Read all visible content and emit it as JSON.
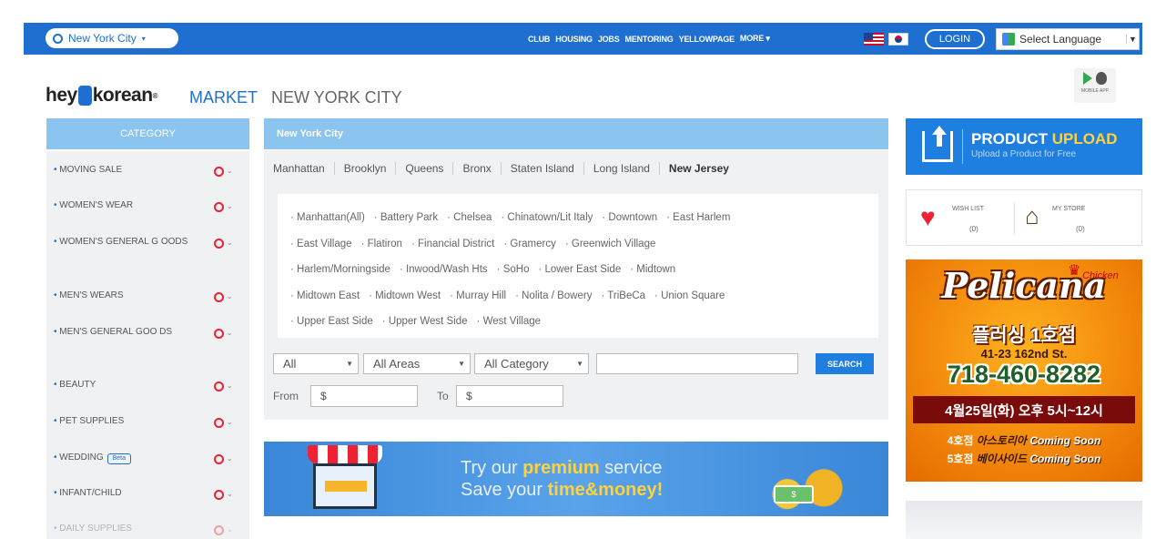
{
  "topbar": {
    "city": "New York City",
    "nav": [
      "CLUB",
      "HOUSING",
      "JOBS",
      "MENTORING",
      "YELLOWPAGE",
      "MORE ▾"
    ],
    "login": "LOGIN",
    "language": "Select Language"
  },
  "header": {
    "logo_pre": "hey",
    "logo_post": "korean",
    "logo_reg": "®",
    "market": "MARKET",
    "city_title": "NEW YORK CITY",
    "mobile_app": "MOBILE APP"
  },
  "sidebar": {
    "title": "CATEGORY",
    "items": [
      "MOVING SALE",
      "WOMEN'S WEAR",
      "WOMEN'S GENERAL G OODS",
      "MEN'S WEARS",
      "MEN'S GENERAL GOO DS",
      "BEAUTY",
      "PET SUPPLIES",
      "WEDDING",
      "INFANT/CHILD",
      "DAILY SUPPLIES"
    ],
    "beta_label": "Beta"
  },
  "main": {
    "city_bar": "New York City",
    "boroughs": [
      "Manhattan",
      "Brooklyn",
      "Queens",
      "Bronx",
      "Staten Island",
      "Long Island",
      "New Jersey"
    ],
    "neighborhoods": [
      "Manhattan(All)",
      "Battery Park",
      "Chelsea",
      "Chinatown/Lit Italy",
      "Downtown",
      "East Harlem",
      "East Village",
      "Flatiron",
      "Financial District",
      "Gramercy",
      "Greenwich Village",
      "Harlem/Morningside",
      "Inwood/Wash Hts",
      "SoHo",
      "Lower East Side",
      "Midtown",
      "Midtown East",
      "Midtown West",
      "Murray Hill",
      "Nolita / Bowery",
      "TriBeCa",
      "Union Square",
      "Upper East Side",
      "Upper West Side",
      "West Village"
    ],
    "filters": {
      "type": "All",
      "area": "All Areas",
      "category": "All Category",
      "search_value": "",
      "search_button": "SEARCH",
      "from_label": "From",
      "to_label": "To",
      "currency": "$"
    },
    "premium": {
      "line1_pre": "Try our ",
      "line1_bold": "premium",
      "line1_post": " service",
      "line2_pre": "Save your ",
      "line2_bold": "time&money!"
    }
  },
  "right": {
    "upload_title_a": "PRODUCT ",
    "upload_title_b": "UPLOAD",
    "upload_sub": "Upload a Product for Free",
    "wishlist_label": "WISH LIST",
    "wishlist_count": "(0)",
    "mystore_label": "MY STORE",
    "mystore_count": "(0)",
    "ad": {
      "brand": "Pelicana",
      "script": "Chicken",
      "branch": "플러싱 1호점",
      "address": "41-23 162nd St.",
      "phone": "718-460-8282",
      "hours": "4월25일(화) 오후 5시~12시",
      "soon1_a": "4호점",
      "soon1_b": " 아스토리아 ",
      "soon2_a": "5호점",
      "soon2_b": " 베이사이드 ",
      "soon_text": "Coming Soon"
    }
  },
  "colors": {
    "brand_blue": "#1f6fd0",
    "light_blue": "#8bc4ef",
    "accent_red": "#e22233"
  }
}
